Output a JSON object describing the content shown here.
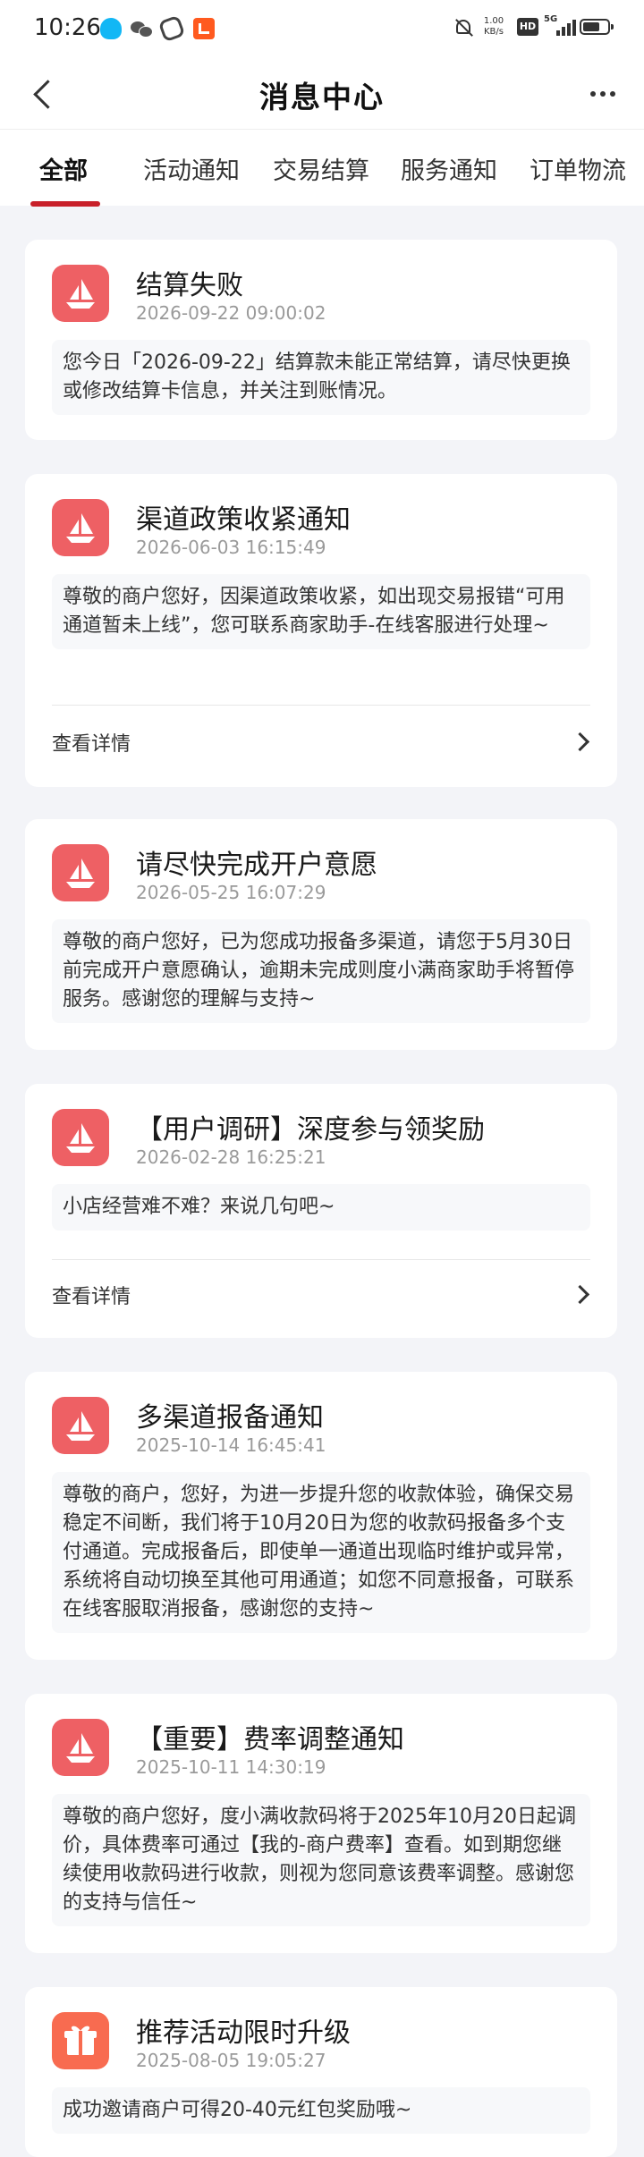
{
  "status_bar": {
    "time": "10:26",
    "net_speed": "1.00 KB/s",
    "hd": "HD",
    "network": "5G"
  },
  "header": {
    "title": "消息中心"
  },
  "tabs": [
    {
      "label": "全部",
      "active": true
    },
    {
      "label": "活动通知"
    },
    {
      "label": "交易结算"
    },
    {
      "label": "服务通知"
    },
    {
      "label": "订单物流"
    }
  ],
  "messages": [
    {
      "title": "结算失败",
      "time": "2026-09-22 09:00:02",
      "content": "您今日「2026-09-22」结算款未能正常结算，请尽快更换或修改结算卡信息，并关注到账情况。",
      "icon": "sail-icon"
    },
    {
      "title": "渠道政策收紧通知",
      "time": "2026-06-03 16:15:49",
      "content": "尊敬的商户您好，因渠道政策收紧，如出现交易报错“可用通道暂未上线”，您可联系商家助手-在线客服进行处理~",
      "icon": "sail-icon",
      "link": "查看详情"
    },
    {
      "title": "请尽快完成开户意愿",
      "time": "2026-05-25 16:07:29",
      "content": "尊敬的商户您好，已为您成功报备多渠道，请您于5月30日前完成开户意愿确认，逾期未完成则度小满商家助手将暂停服务。感谢您的理解与支持~",
      "icon": "sail-icon"
    },
    {
      "title": "【用户调研】深度参与领奖励",
      "time": "2026-02-28 16:25:21",
      "content": "小店经营难不难？来说几句吧~",
      "icon": "sail-icon",
      "link": "查看详情"
    },
    {
      "title": "多渠道报备通知",
      "time": "2025-10-14 16:45:41",
      "content": "尊敬的商户，您好，为进一步提升您的收款体验，确保交易稳定不间断，我们将于10月20日为您的收款码报备多个支付通道。完成报备后，即使单一通道出现临时维护或异常，系统将自动切换至其他可用通道；如您不同意报备，可联系在线客服取消报备，感谢您的支持~",
      "icon": "sail-icon"
    },
    {
      "title": "【重要】费率调整通知",
      "time": "2025-10-11 14:30:19",
      "content": "尊敬的商户您好，度小满收款码将于2025年10月20日起调价，具体费率可通过【我的-商户费率】查看。如到期您继续使用收款码进行收款，则视为您同意该费率调整。感谢您的支持与信任~",
      "icon": "sail-icon"
    },
    {
      "title": "推荐活动限时升级",
      "time": "2025-08-05 19:05:27",
      "content": "成功邀请商户可得20-40元红包奖励哦~",
      "icon": "gift-icon"
    }
  ]
}
